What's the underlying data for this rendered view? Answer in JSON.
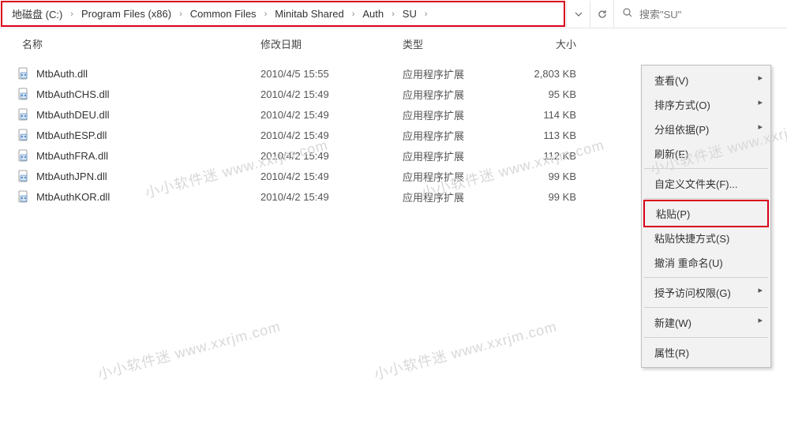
{
  "breadcrumb": {
    "items": [
      "地磁盘 (C:)",
      "Program Files (x86)",
      "Common Files",
      "Minitab Shared",
      "Auth",
      "SU"
    ]
  },
  "search": {
    "placeholder": "搜索\"SU\""
  },
  "columns": {
    "name": "名称",
    "date": "修改日期",
    "type": "类型",
    "size": "大小"
  },
  "files": [
    {
      "name": "MtbAuth.dll",
      "date": "2010/4/5 15:55",
      "type": "应用程序扩展",
      "size": "2,803 KB"
    },
    {
      "name": "MtbAuthCHS.dll",
      "date": "2010/4/2 15:49",
      "type": "应用程序扩展",
      "size": "95 KB"
    },
    {
      "name": "MtbAuthDEU.dll",
      "date": "2010/4/2 15:49",
      "type": "应用程序扩展",
      "size": "114 KB"
    },
    {
      "name": "MtbAuthESP.dll",
      "date": "2010/4/2 15:49",
      "type": "应用程序扩展",
      "size": "113 KB"
    },
    {
      "name": "MtbAuthFRA.dll",
      "date": "2010/4/2 15:49",
      "type": "应用程序扩展",
      "size": "112 KB"
    },
    {
      "name": "MtbAuthJPN.dll",
      "date": "2010/4/2 15:49",
      "type": "应用程序扩展",
      "size": "99 KB"
    },
    {
      "name": "MtbAuthKOR.dll",
      "date": "2010/4/2 15:49",
      "type": "应用程序扩展",
      "size": "99 KB"
    }
  ],
  "menu": {
    "view": "查看(V)",
    "sort": "排序方式(O)",
    "group": "分组依据(P)",
    "refresh": "刷新(E)",
    "customize": "自定义文件夹(F)...",
    "paste": "粘贴(P)",
    "paste_shortcut": "粘贴快捷方式(S)",
    "undo": "撤消 重命名(U)",
    "grant": "授予访问权限(G)",
    "new": "新建(W)",
    "properties": "属性(R)"
  },
  "watermark": "小小软件迷 www.xxrjm.com"
}
